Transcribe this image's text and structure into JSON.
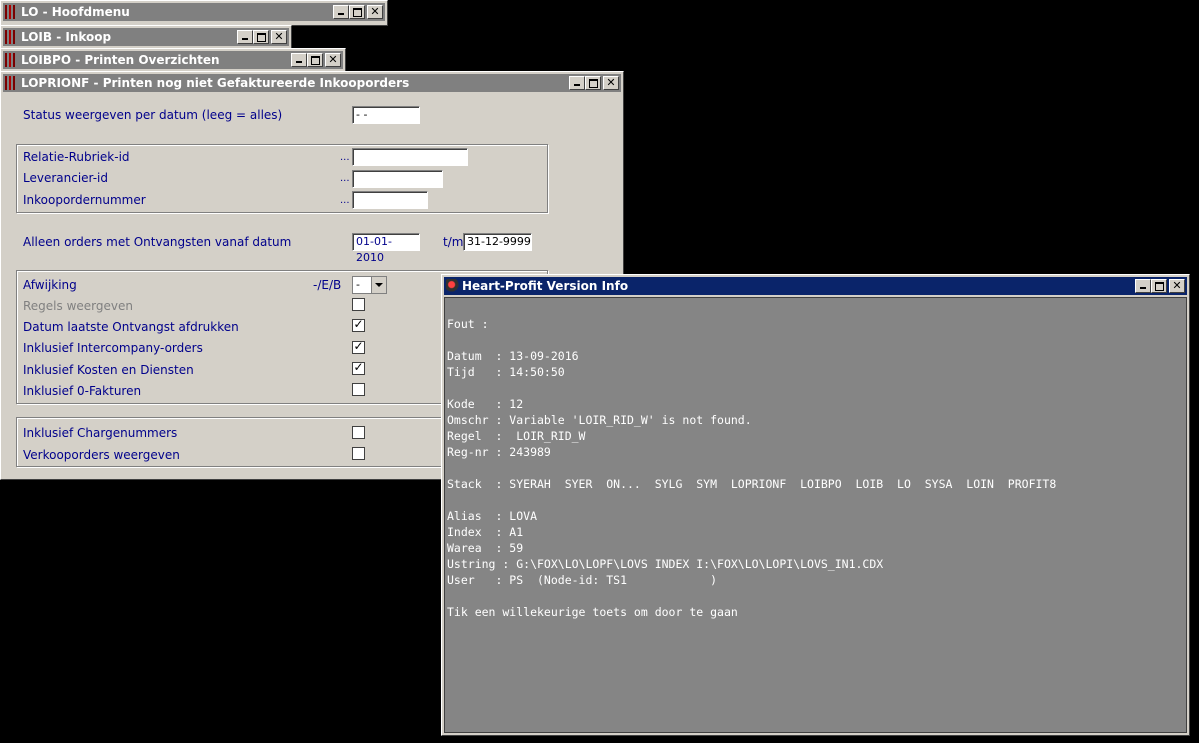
{
  "windows": {
    "lo": {
      "title": "LO - Hoofdmenu"
    },
    "loib": {
      "title": "LOIB - Inkoop"
    },
    "loibpo": {
      "title": "LOIBPO - Printen Overzichten"
    },
    "loprionf": {
      "title": "LOPRIONF - Printen nog niet Gefaktureerde Inkooporders"
    }
  },
  "form": {
    "status_label": "Status weergeven per datum (leeg = alles)",
    "status_value": "- -",
    "relatie_label": "Relatie-Rubriek-id",
    "leverancier_label": "Leverancier-id",
    "inkooporder_label": "Inkoopordernummer",
    "dots": "...",
    "ontvangst_label": "Alleen orders met Ontvangsten vanaf datum",
    "date_from": "01-01-2010",
    "tm_label": "t/m",
    "date_to": "31-12-9999",
    "afwijking_label": "Afwijking",
    "afwijking_options_label": "-/E/B",
    "afwijking_value": "-",
    "regels_label": "Regels weergeven",
    "datum_laatste_label": "Datum laatste Ontvangst afdrukken",
    "intercompany_label": "Inklusief Intercompany-orders",
    "kosten_label": "Inklusief Kosten en Diensten",
    "nulfakturen_label": "Inklusief 0-Fakturen",
    "charge_label": "Inklusief Chargenummers",
    "verkoop_label": "Verkooporders weergeven",
    "check_mark": "✓"
  },
  "version_info": {
    "title": "Heart-Profit Version Info",
    "lines": [
      "Fout :",
      "",
      "Datum  : 13-09-2016",
      "Tijd   : 14:50:50",
      "",
      "Kode   : 12",
      "Omschr : Variable 'LOIR_RID_W' is not found.",
      "Regel  :  LOIR_RID_W",
      "Reg-nr : 243989",
      "",
      "Stack  : SYERAH  SYER  ON...  SYLG  SYM  LOPRIONF  LOIBPO  LOIB  LO  SYSA  LOIN  PROFIT8",
      "",
      "Alias  : LOVA",
      "Index  : A1",
      "Warea  : 59",
      "Ustring : G:\\FOX\\LO\\LOPF\\LOVS INDEX I:\\FOX\\LO\\LOPI\\LOVS_IN1.CDX",
      "User   : PS  (Node-id: TS1            )",
      "",
      "Tik een willekeurige toets om door te gaan"
    ]
  },
  "colors": {
    "inactive_title": "#808080",
    "active_title": "#0a246a",
    "label_blue": "#00008b",
    "console_bg": "#858585"
  }
}
